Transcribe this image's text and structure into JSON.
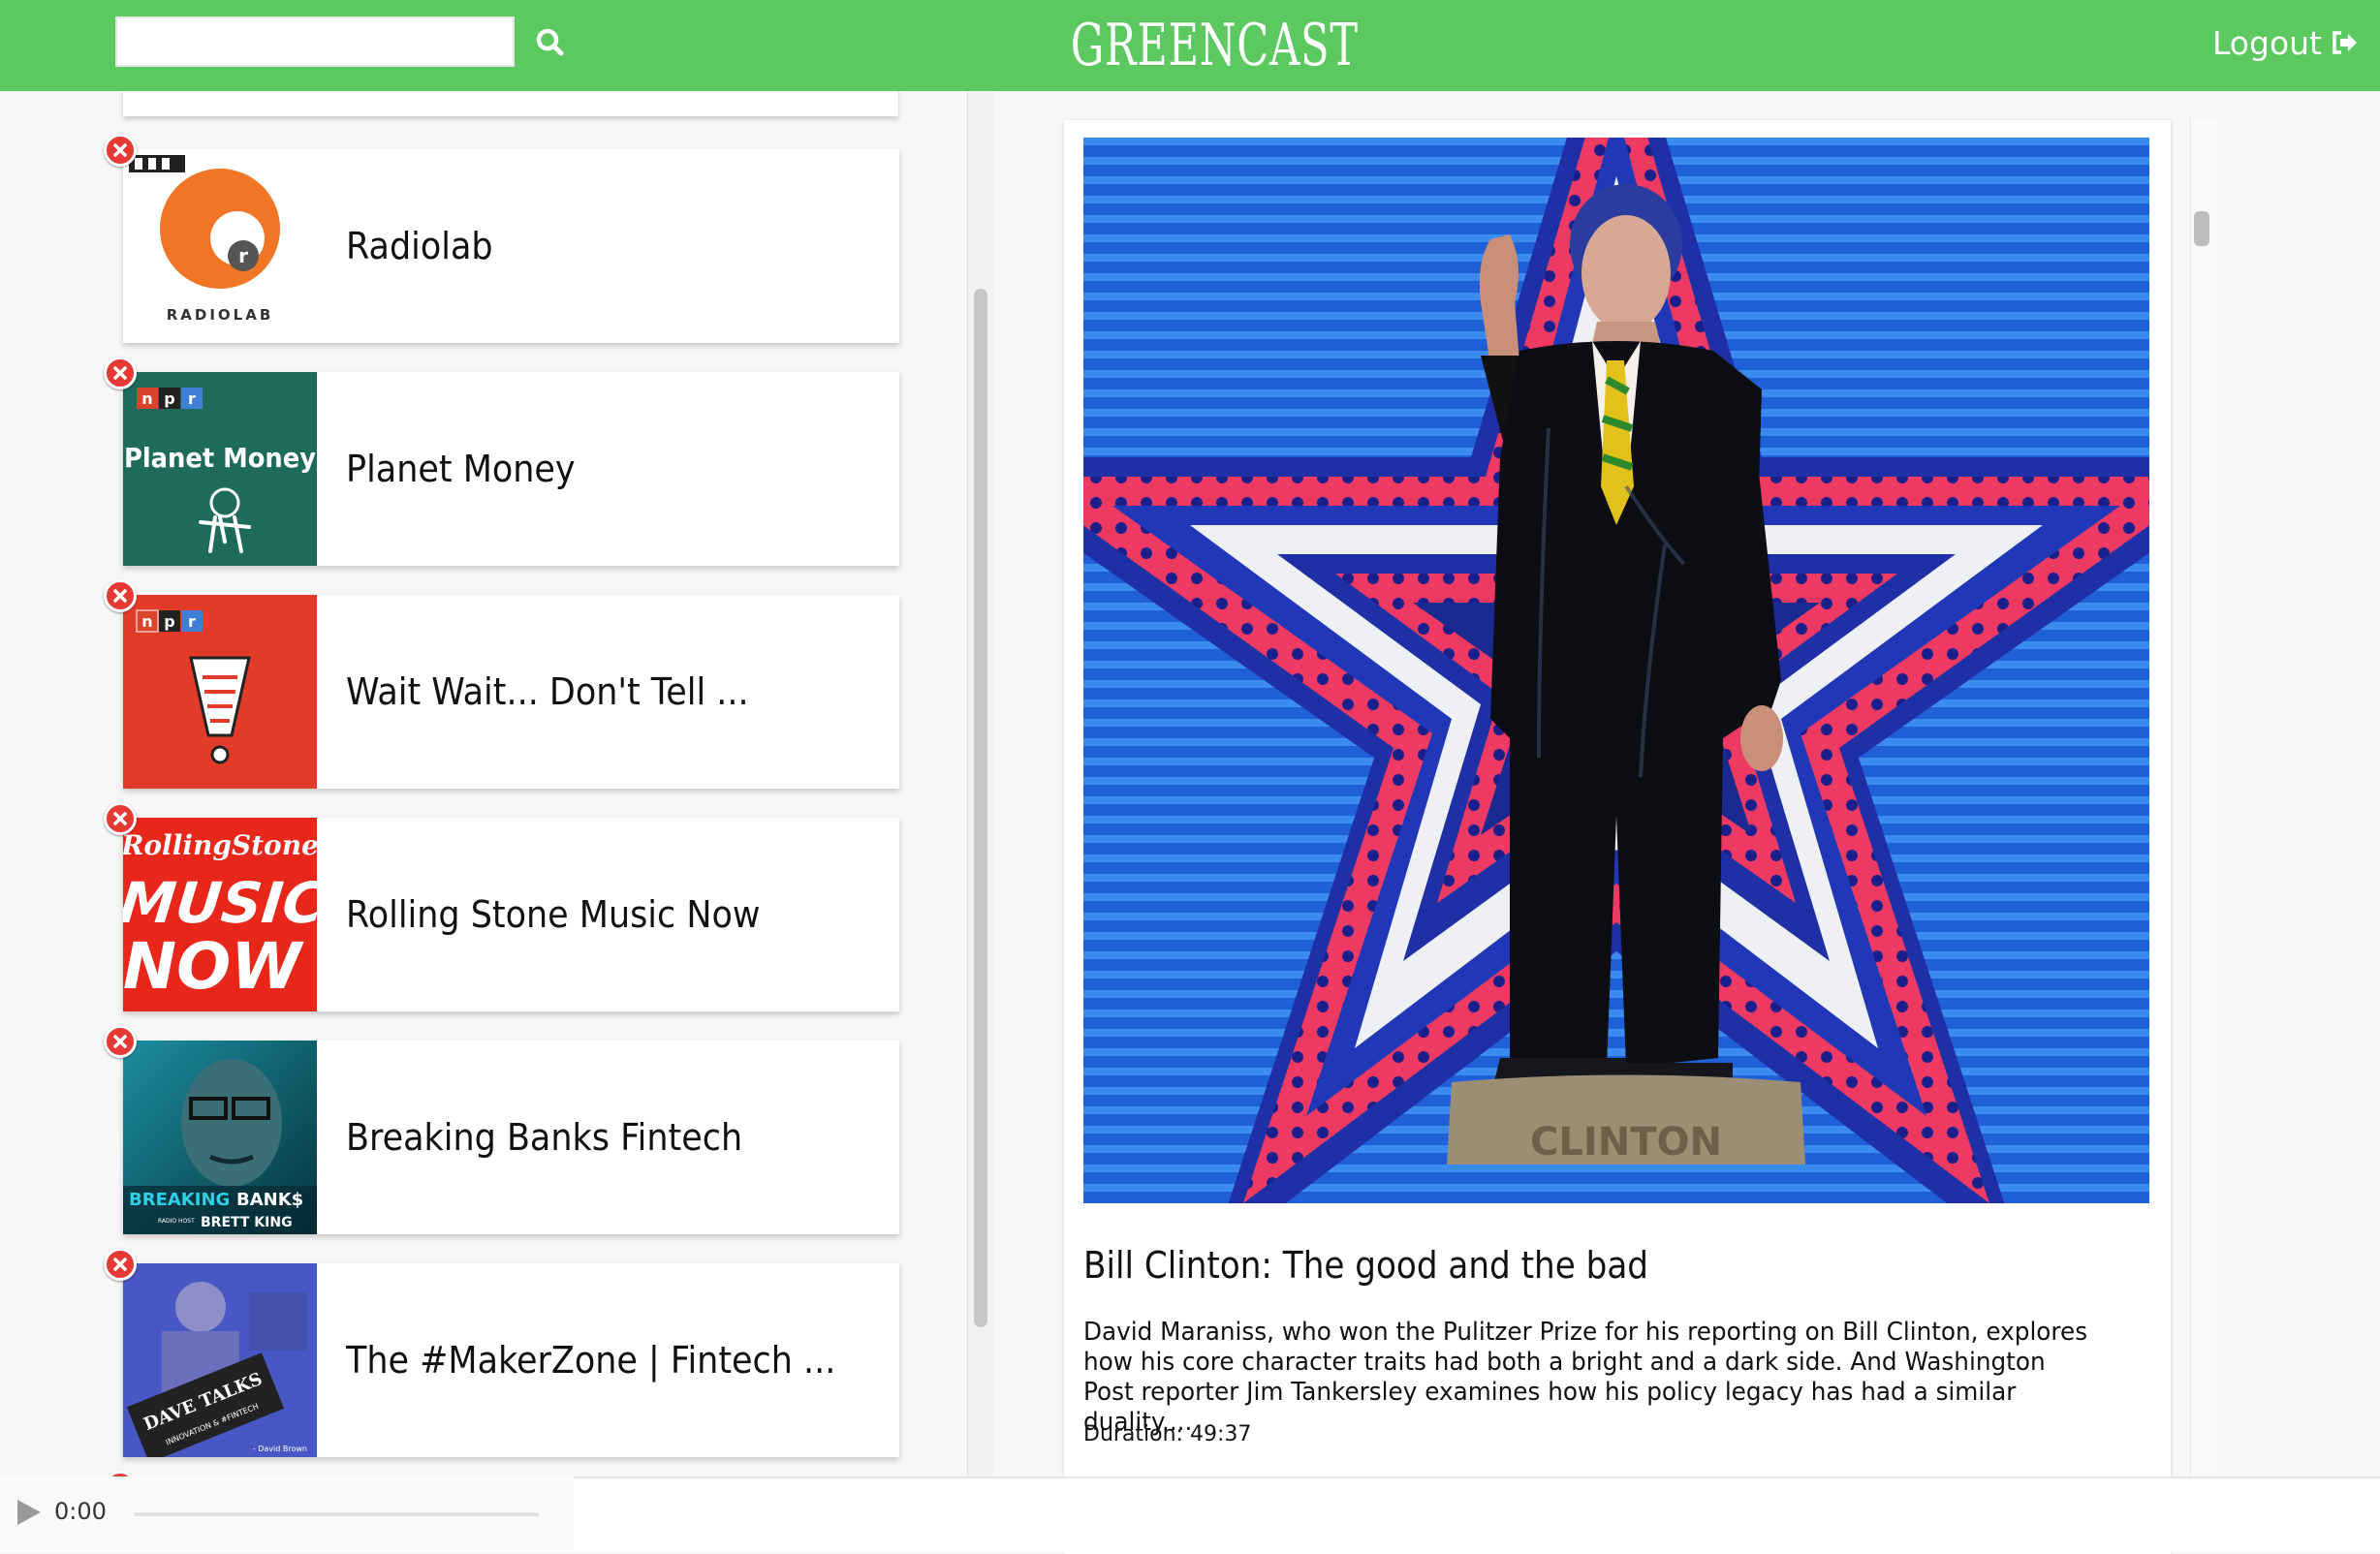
{
  "header": {
    "brand": "GREENCAST",
    "search": {
      "value": "",
      "placeholder": ""
    },
    "logout_label": "Logout"
  },
  "subscriptions": [
    {
      "title": "Radiolab",
      "art": "radiolab-artwork"
    },
    {
      "title": "Planet Money",
      "art": "planet-money-artwork"
    },
    {
      "title": "Wait Wait... Don't Tell ...",
      "art": "wait-wait-artwork"
    },
    {
      "title": "Rolling Stone Music Now",
      "art": "rolling-stone-artwork"
    },
    {
      "title": "Breaking Banks Fintech",
      "art": "breaking-banks-artwork"
    },
    {
      "title": "The #MakerZone | Fintech ...",
      "art": "makerzone-artwork"
    }
  ],
  "artwork_text": {
    "radiolab": "RADIOLAB",
    "npr": "npr",
    "planet_money": "Planet Money",
    "rs_brand": "RollingStone",
    "rs_music": "MUSIC",
    "rs_now": "NOW",
    "bb_breaking": "BREAKING",
    "bb_banks": "BANK$",
    "bb_host": "RADIO HOST",
    "bb_name": "BRETT KING",
    "mz_line1": "DAVE TALKS",
    "mz_line2": "INNOVATION & #FINTECH",
    "mz_sign": "- David Brown",
    "clinton_plinth": "CLINTON"
  },
  "episode": {
    "title": "Bill Clinton: The good and the bad",
    "description": "David Maraniss, who won the Pulitzer Prize for his reporting on Bill Clinton, explores how his core character traits had both a bright and a dark side. And Washington Post reporter Jim Tankersley examines how his policy legacy has had a similar duality....",
    "duration_label": "Duration: 49:37"
  },
  "player": {
    "time": "0:00"
  },
  "colors": {
    "brand_green": "#5cc860",
    "remove_red": "#e53935"
  },
  "icons": {
    "search": "search-icon",
    "logout": "sign-out-icon",
    "remove": "close-icon",
    "play": "play-icon"
  }
}
